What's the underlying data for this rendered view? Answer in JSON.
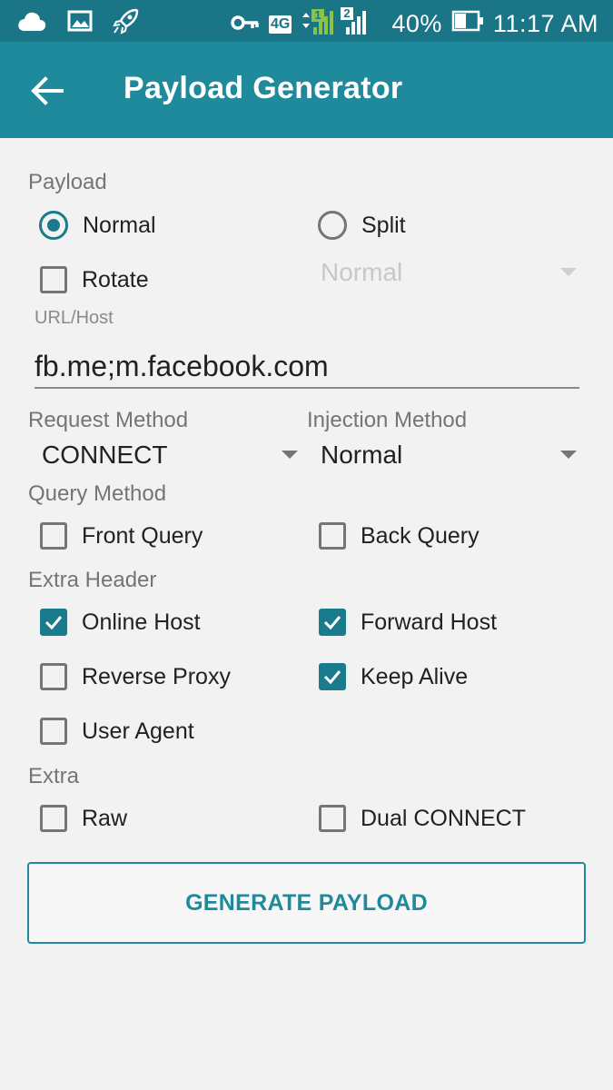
{
  "status_bar": {
    "network": "4G",
    "sim1": "1",
    "sim2": "2",
    "battery": "40%",
    "time": "11:17 AM",
    "icons": [
      "cloud-icon",
      "image-icon",
      "rocket-icon",
      "key-icon",
      "signal-icon",
      "battery-icon"
    ]
  },
  "appbar": {
    "title": "Payload Generator"
  },
  "payload": {
    "section_label": "Payload",
    "normal_label": "Normal",
    "split_label": "Split",
    "rotate_label": "Rotate",
    "split_mode_value": "Normal",
    "selected": "Normal"
  },
  "url": {
    "label": "URL/Host",
    "value": "fb.me;m.facebook.com"
  },
  "request_method": {
    "label": "Request Method",
    "value": "CONNECT"
  },
  "injection_method": {
    "label": "Injection Method",
    "value": "Normal"
  },
  "query_method": {
    "section_label": "Query Method",
    "front_label": "Front Query",
    "back_label": "Back Query"
  },
  "extra_header": {
    "section_label": "Extra Header",
    "online_host_label": "Online Host",
    "forward_host_label": "Forward Host",
    "reverse_proxy_label": "Reverse Proxy",
    "keep_alive_label": "Keep Alive",
    "user_agent_label": "User Agent"
  },
  "extra": {
    "section_label": "Extra",
    "raw_label": "Raw",
    "dual_connect_label": "Dual CONNECT"
  },
  "generate_button": "GENERATE PAYLOAD",
  "colors": {
    "accent": "#1e8a9c",
    "status_bar": "#1a7587",
    "background": "#f2f2f2"
  }
}
